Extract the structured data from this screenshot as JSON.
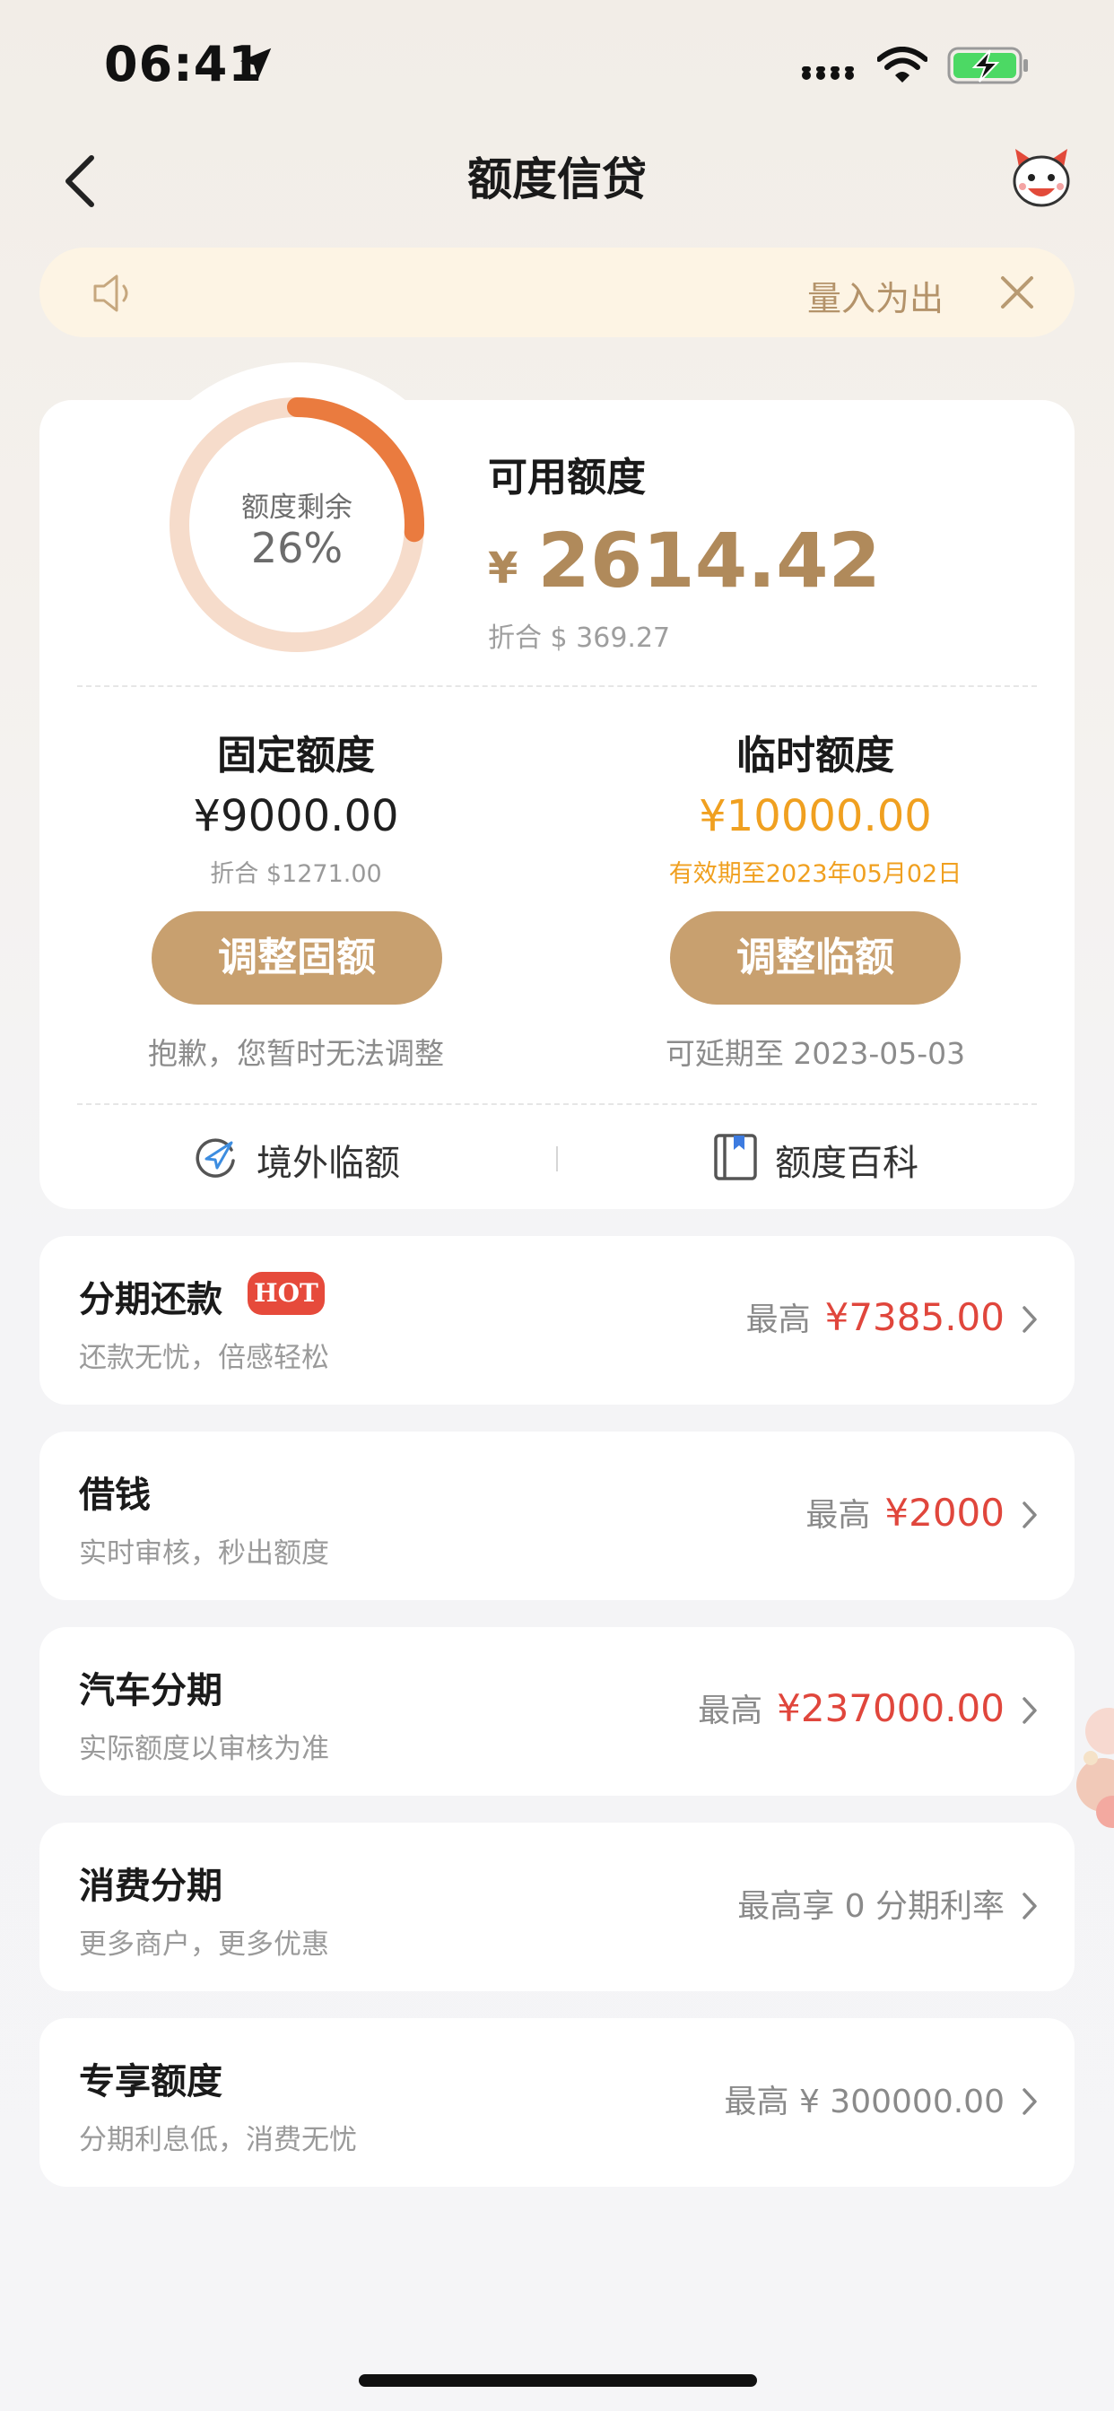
{
  "status_bar": {
    "time": "06:41"
  },
  "nav": {
    "title": "额度信贷"
  },
  "notice": {
    "text": "量入为出"
  },
  "credit": {
    "ring_label": "额度剩余",
    "ring_percent": "26%",
    "remaining_fraction": 0.26,
    "available_title": "可用额度",
    "currency_symbol": "¥",
    "available_amount": "2614.42",
    "available_converted": "折合 $ 369.27"
  },
  "fixed": {
    "title": "固定额度",
    "amount": "¥9000.00",
    "converted": "折合 $1271.00",
    "button_label": "调整固额",
    "note": "抱歉，您暂时无法调整"
  },
  "temporary": {
    "title": "临时额度",
    "amount": "¥10000.00",
    "validity": "有效期至2023年05月02日",
    "button_label": "调整临额",
    "note": "可延期至 2023-05-03"
  },
  "links": {
    "overseas_label": "境外临额",
    "encyclopedia_label": "额度百科"
  },
  "products": [
    {
      "title": "分期还款",
      "badge": "HOT",
      "subtitle": "还款无忧，倍感轻松",
      "prefix": "最高",
      "amount": "¥7385.00"
    },
    {
      "title": "借钱",
      "subtitle": "实时审核，秒出额度",
      "prefix": "最高",
      "amount": "¥2000"
    },
    {
      "title": "汽车分期",
      "subtitle": "实际额度以审核为准",
      "prefix": "最高",
      "amount": "¥237000.00"
    },
    {
      "title": "消费分期",
      "subtitle": "更多商户，更多优惠",
      "prefix": "最高享 0 分期利率",
      "amount": ""
    },
    {
      "title": "专享额度",
      "subtitle": "分期利息低，消费无忧",
      "prefix": "最高 ¥ 300000.00",
      "amount": ""
    }
  ],
  "colors": {
    "accent_gold": "#b08a5b",
    "button_gold": "#c8a06f",
    "ring_orange": "#ea7b3f",
    "ring_track": "#f6dccb",
    "temp_amount": "#f0a020",
    "price_red": "#e0463c",
    "notice_bg": "#fdf4e4"
  },
  "icons": [
    "location-arrow-icon",
    "signal-icon",
    "wifi-icon",
    "battery-charging-icon",
    "back-chevron-icon",
    "mascot-icon",
    "speaker-icon",
    "close-icon",
    "overseas-plane-icon",
    "book-icon",
    "chevron-right-icon"
  ]
}
